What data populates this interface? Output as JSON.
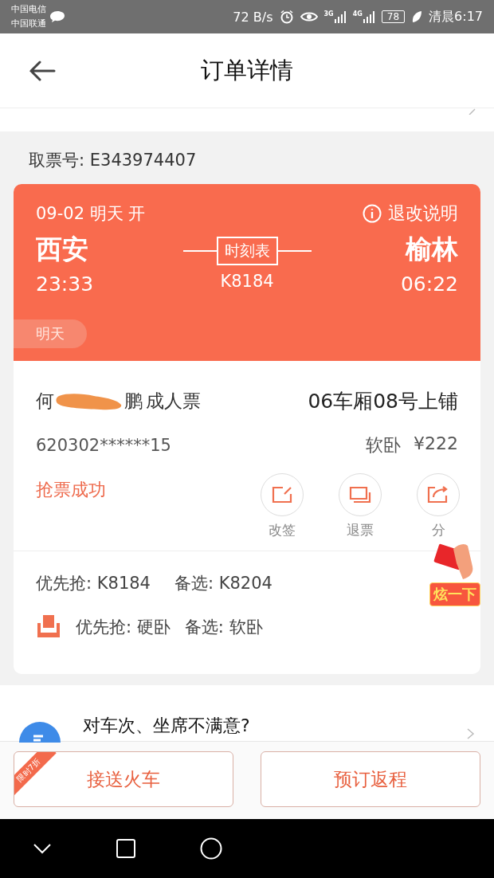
{
  "status_bar": {
    "carriers": [
      "中国电信",
      "中国联通"
    ],
    "speed": "72 B/s",
    "network_labels": [
      "3G",
      "4G"
    ],
    "battery": "78",
    "time": "清晨6:17"
  },
  "header": {
    "title": "订单详情"
  },
  "pickup": "取票号: E343974407",
  "trip": {
    "date": "09-02 明天 开",
    "refund_info": "退改说明",
    "from": {
      "station": "西安",
      "time": "23:33"
    },
    "to": {
      "station": "榆林",
      "time": "06:22"
    },
    "timetable": "时刻表",
    "train": "K8184",
    "day_tag": "明天"
  },
  "passenger": {
    "name_start": "何",
    "name_end": "鹏",
    "ticket_type": "成人票",
    "seat": "06车厢08号上铺",
    "id_number": "620302******15",
    "seat_class": "软卧",
    "price": "¥222",
    "status": "抢票成功",
    "actions": [
      {
        "label": "改签",
        "kind": "change"
      },
      {
        "label": "退票",
        "kind": "refund"
      },
      {
        "label": "分",
        "kind": "share"
      }
    ]
  },
  "preferences": {
    "trains": [
      "优先抢: K8184",
      "备选: K8204"
    ],
    "seats": [
      "优先抢: 硬卧",
      "备选: 软卧"
    ]
  },
  "promo_sticker": "炫一下",
  "feedback": "对车次、坐席不满意?",
  "bottom_buttons": [
    {
      "label": "接送火车",
      "ribbon": "限时7折"
    },
    {
      "label": "预订返程"
    }
  ]
}
